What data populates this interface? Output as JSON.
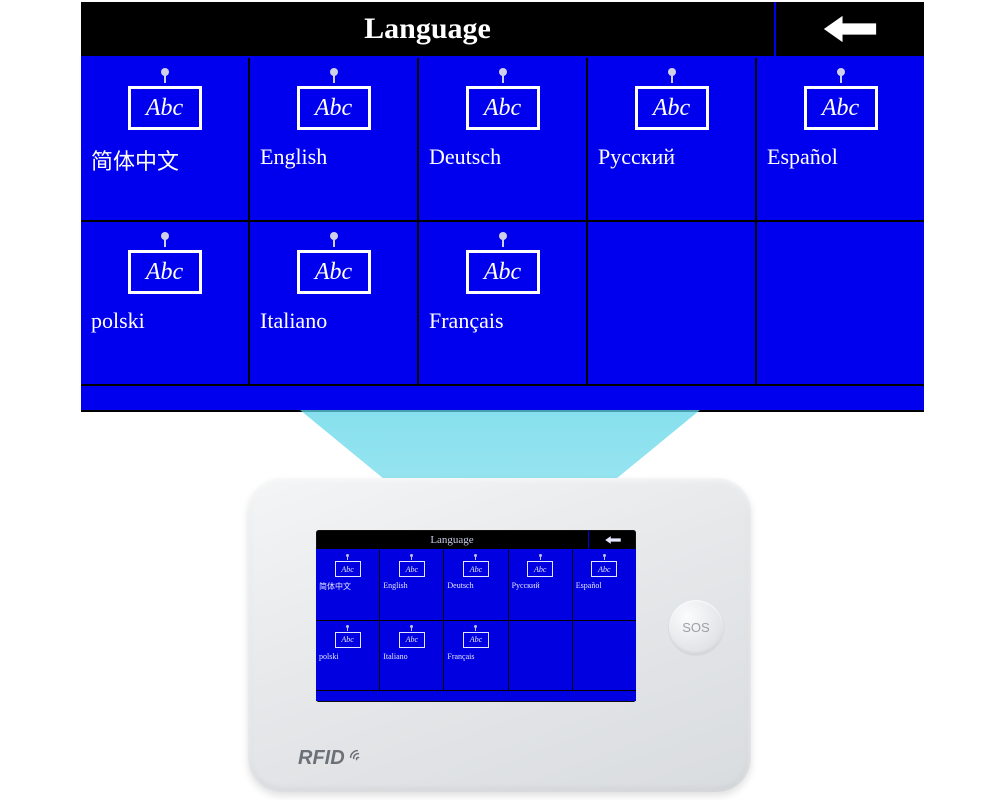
{
  "screen": {
    "title": "Language",
    "icon_text": "Abc",
    "languages": [
      {
        "label": "简体中文"
      },
      {
        "label": "English"
      },
      {
        "label": "Deutsch"
      },
      {
        "label": "Русский"
      },
      {
        "label": "Español"
      },
      {
        "label": "polski"
      },
      {
        "label": "Italiano"
      },
      {
        "label": "Français"
      }
    ]
  },
  "device": {
    "sos_label": "SOS",
    "rfid_label": "RFID"
  }
}
